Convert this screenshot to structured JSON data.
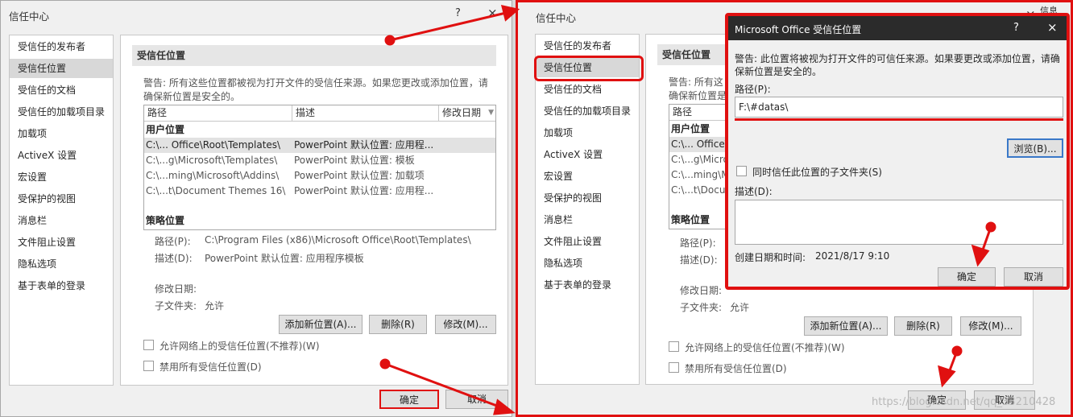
{
  "left_window": {
    "title": "信任中心",
    "help": "?",
    "close": "×",
    "nav": [
      "受信任的发布者",
      "受信任位置",
      "受信任的文档",
      "受信任的加载项目录",
      "加载项",
      "ActiveX 设置",
      "宏设置",
      "受保护的视图",
      "消息栏",
      "文件阻止设置",
      "隐私选项",
      "基于表单的登录"
    ],
    "section_title": "受信任位置",
    "warning": [
      "警告: 所有这些位置都被视为打开文件的受信任来源。如果您更改或添加位置，请",
      "确保新位置是安全的。"
    ],
    "columns": [
      "路径",
      "描述",
      "修改日期"
    ],
    "group_user": "用户位置",
    "rows": [
      {
        "path": "C:\\... Office\\Root\\Templates\\",
        "desc": "PowerPoint 默认位置: 应用程..."
      },
      {
        "path": "C:\\...g\\Microsoft\\Templates\\",
        "desc": "PowerPoint 默认位置: 模板"
      },
      {
        "path": "C:\\...ming\\Microsoft\\Addins\\",
        "desc": "PowerPoint 默认位置: 加载项"
      },
      {
        "path": "C:\\...t\\Document Themes 16\\",
        "desc": "PowerPoint 默认位置: 应用程..."
      }
    ],
    "group_policy": "策略位置",
    "detail_path_label": "路径(P):",
    "detail_path_value": "C:\\Program Files (x86)\\Microsoft Office\\Root\\Templates\\",
    "detail_desc_label": "描述(D):",
    "detail_desc_value": "PowerPoint 默认位置: 应用程序模板",
    "detail_date_label": "修改日期:",
    "detail_sub_label": "子文件夹:",
    "detail_sub_value": "允许",
    "btn_add": "添加新位置(A)...",
    "btn_delete": "删除(R)",
    "btn_modify": "修改(M)...",
    "chk_network": "允许网络上的受信任位置(不推荐)(W)",
    "chk_disable": "禁用所有受信任位置(D)",
    "ok": "确定",
    "cancel": "取消"
  },
  "right_window": {
    "title": "信任中心",
    "close": "×",
    "nav": [
      "受信任的发布者",
      "受信任位置",
      "受信任的文档",
      "受信任的加载项目录",
      "加载项",
      "ActiveX 设置",
      "宏设置",
      "受保护的视图",
      "消息栏",
      "文件阻止设置",
      "隐私选项",
      "基于表单的登录"
    ],
    "section_title": "受信任位置",
    "warning_partial": [
      "警告: 所有这",
      "确保新位置是"
    ],
    "col_path": "路径",
    "group_user": "用户位置",
    "rows_partial": [
      "C:\\... Office\\",
      "C:\\...g\\Micro",
      "C:\\...ming\\M",
      "C:\\...t\\Docu"
    ],
    "group_policy": "策略位置",
    "detail_path_label": "路径(P):",
    "detail_desc_label": "描述(D):",
    "detail_date_label": "修改日期:",
    "detail_sub_label": "子文件夹:",
    "detail_sub_value": "允许",
    "btn_add": "添加新位置(A)...",
    "btn_delete": "删除(R)",
    "btn_modify": "修改(M)...",
    "chk_network": "允许网络上的受信任位置(不推荐)(W)",
    "chk_disable": "禁用所有受信任位置(D)",
    "ok": "确定",
    "cancel": "取消",
    "corner_text": "信息"
  },
  "dialog": {
    "title": "Microsoft Office 受信任位置",
    "help": "?",
    "close": "×",
    "warning": [
      "警告: 此位置将被视为打开文件的可信任来源。如果要更改或添加位置，请确",
      "保新位置是安全的。"
    ],
    "path_label": "路径(P):",
    "path_value": "F:\\#datas\\",
    "browse": "浏览(B)...",
    "subfolder_label": "同时信任此位置的子文件夹(S)",
    "desc_label": "描述(D):",
    "date_label": "创建日期和时间:",
    "date_value": "2021/8/17 9:10",
    "ok": "确定",
    "cancel": "取消"
  },
  "watermark": "https://blog.csdn.net/qq_33210428",
  "accent_red": "#e01010"
}
